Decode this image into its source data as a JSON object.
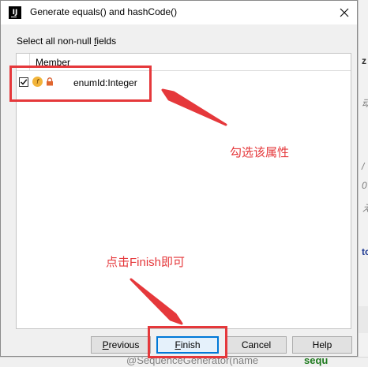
{
  "dialog": {
    "title": "Generate equals() and hashCode()",
    "app_icon_glyph": "IJ",
    "select_label_prefix": "Select all non-null ",
    "select_label_mnemonic": "f",
    "select_label_suffix": "ields"
  },
  "table": {
    "column_header": "Member",
    "rows": [
      {
        "checked": true,
        "field_icon_glyph": "f",
        "label": "enumId:Integer"
      }
    ]
  },
  "buttons": {
    "previous": {
      "mnemonic": "P",
      "rest": "revious"
    },
    "finish": {
      "mnemonic": "F",
      "rest": "inish"
    },
    "cancel": {
      "label": "Cancel"
    },
    "help": {
      "label": "Help"
    }
  },
  "annotations": {
    "note_1": "勾选该属性",
    "note_2": "点击Finish即可",
    "color": "#e5383b"
  },
  "background": {
    "fragments": [
      "z",
      "动",
      "/",
      "0",
      "え",
      "to"
    ],
    "bottom_code": "@SequenceGenerator(name",
    "bottom_code_2": "sequ"
  },
  "icons": {
    "close": "close-icon",
    "checkbox": "check-icon",
    "field": "field-icon",
    "lock": "lock-icon"
  }
}
